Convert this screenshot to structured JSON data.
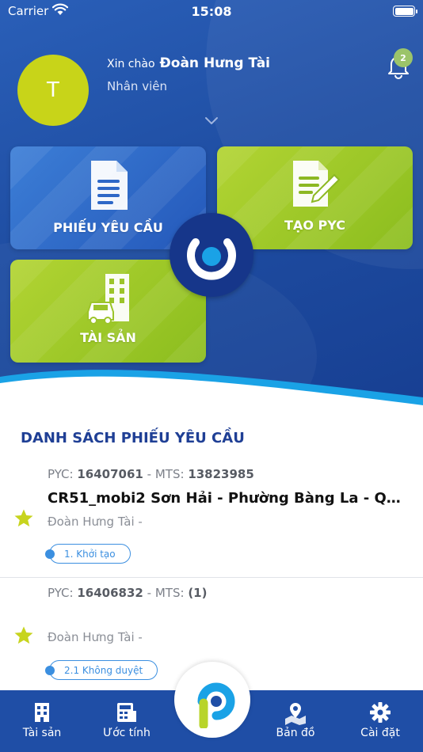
{
  "status_bar": {
    "carrier": "Carrier",
    "time": "15:08"
  },
  "user": {
    "initial": "T",
    "greeting": "Xin chào",
    "name": "Đoàn Hưng Tài",
    "role": "Nhân viên",
    "notification_count": "2"
  },
  "tiles": {
    "requests_label": "PHIẾU YÊU CẦU",
    "create_label": "TẠO PYC",
    "assets_label": "TÀI SẢN"
  },
  "list": {
    "title": "DANH SÁCH PHIẾU YÊU CẦU",
    "pyc_prefix": "PYC:",
    "mts_prefix": "MTS:",
    "items": [
      {
        "pyc": "16407061",
        "mts": "13823985",
        "title": "CR51_mobi2  Sơn Hải - Phường Bàng La - Quận...",
        "person": "Đoàn Hưng Tài -",
        "status": "1. Khởi tạo"
      },
      {
        "pyc": "16406832",
        "mts": "(1)",
        "title": "",
        "person": "Đoàn Hưng Tài -",
        "status": "2.1 Không duyệt"
      }
    ]
  },
  "bottom_nav": {
    "assets": "Tài sản",
    "estimate": "Ước tính",
    "map": "Bản đồ",
    "settings": "Cài đặt"
  },
  "colors": {
    "primary_blue": "#1f4ea6",
    "lime": "#b2d433",
    "title_blue": "#1f3f95",
    "status_blue": "#3b8fe0",
    "star_yellow": "#c7d41e"
  }
}
